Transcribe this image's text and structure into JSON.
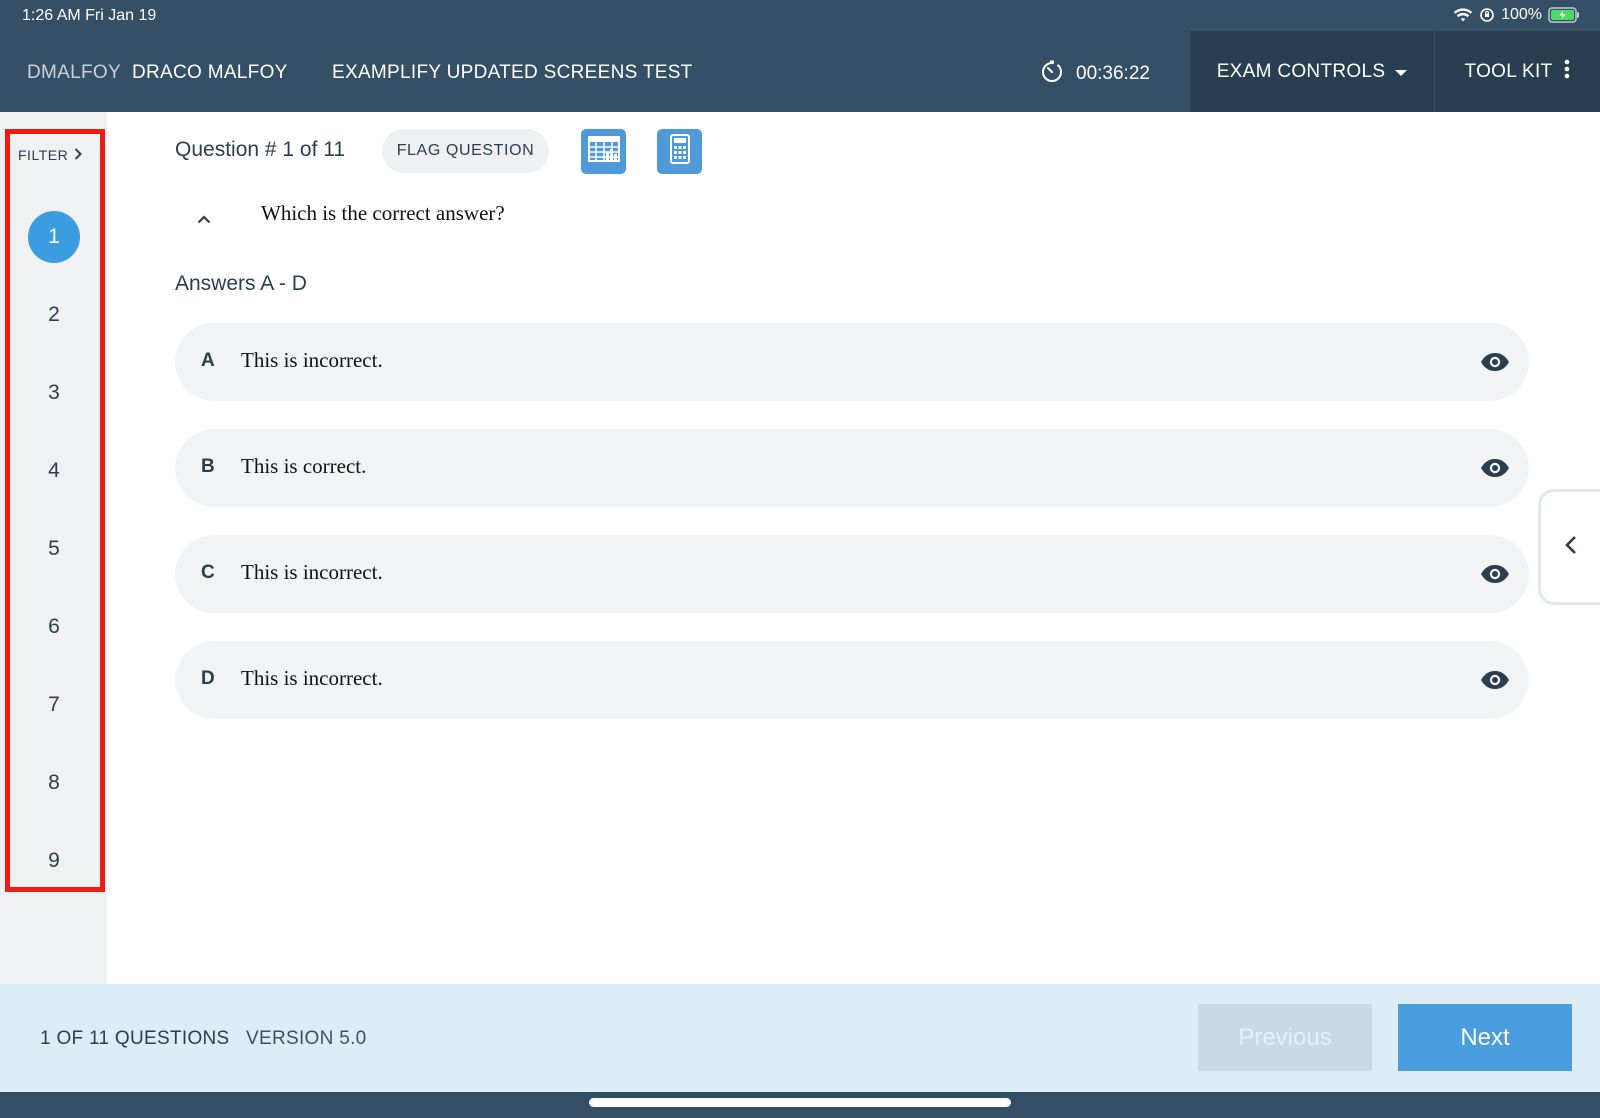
{
  "status_bar": {
    "time": "1:26 AM   Fri Jan 19",
    "battery": "100%"
  },
  "header": {
    "username": "DMALFOY",
    "full_name": "DRACO MALFOY",
    "exam_title": "EXAMPLIFY UPDATED SCREENS TEST",
    "timer": "00:36:22",
    "exam_controls_label": "EXAM CONTROLS",
    "toolkit_label": "TOOL KIT"
  },
  "sidebar": {
    "filter_label": "FILTER",
    "questions": [
      "1",
      "2",
      "3",
      "4",
      "5",
      "6",
      "7",
      "8",
      "9"
    ],
    "active_question": "1"
  },
  "question": {
    "label": "Question # 1 of 11",
    "flag_label": "FLAG QUESTION",
    "text": "Which is the correct answer?",
    "answers_heading": "Answers A - D",
    "answers": [
      {
        "letter": "A",
        "text": "This is incorrect."
      },
      {
        "letter": "B",
        "text": "This is correct."
      },
      {
        "letter": "C",
        "text": "This is incorrect."
      },
      {
        "letter": "D",
        "text": "This is incorrect."
      }
    ]
  },
  "footer": {
    "count": "1 OF 11 QUESTIONS",
    "version": "VERSION 5.0",
    "previous_label": "Previous",
    "next_label": "Next"
  },
  "colors": {
    "header_bg": "#354f67",
    "accent_blue": "#3a9de0",
    "highlight_red": "#ee1c12",
    "footer_bg": "#dcedf7"
  },
  "icons": [
    "wifi-icon",
    "orientation-lock-icon",
    "battery-icon",
    "timer-icon",
    "caret-down-icon",
    "more-vertical-icon",
    "chevron-right-icon",
    "spreadsheet-icon",
    "calculator-icon",
    "chevron-up-icon",
    "eye-icon",
    "chevron-left-icon"
  ]
}
